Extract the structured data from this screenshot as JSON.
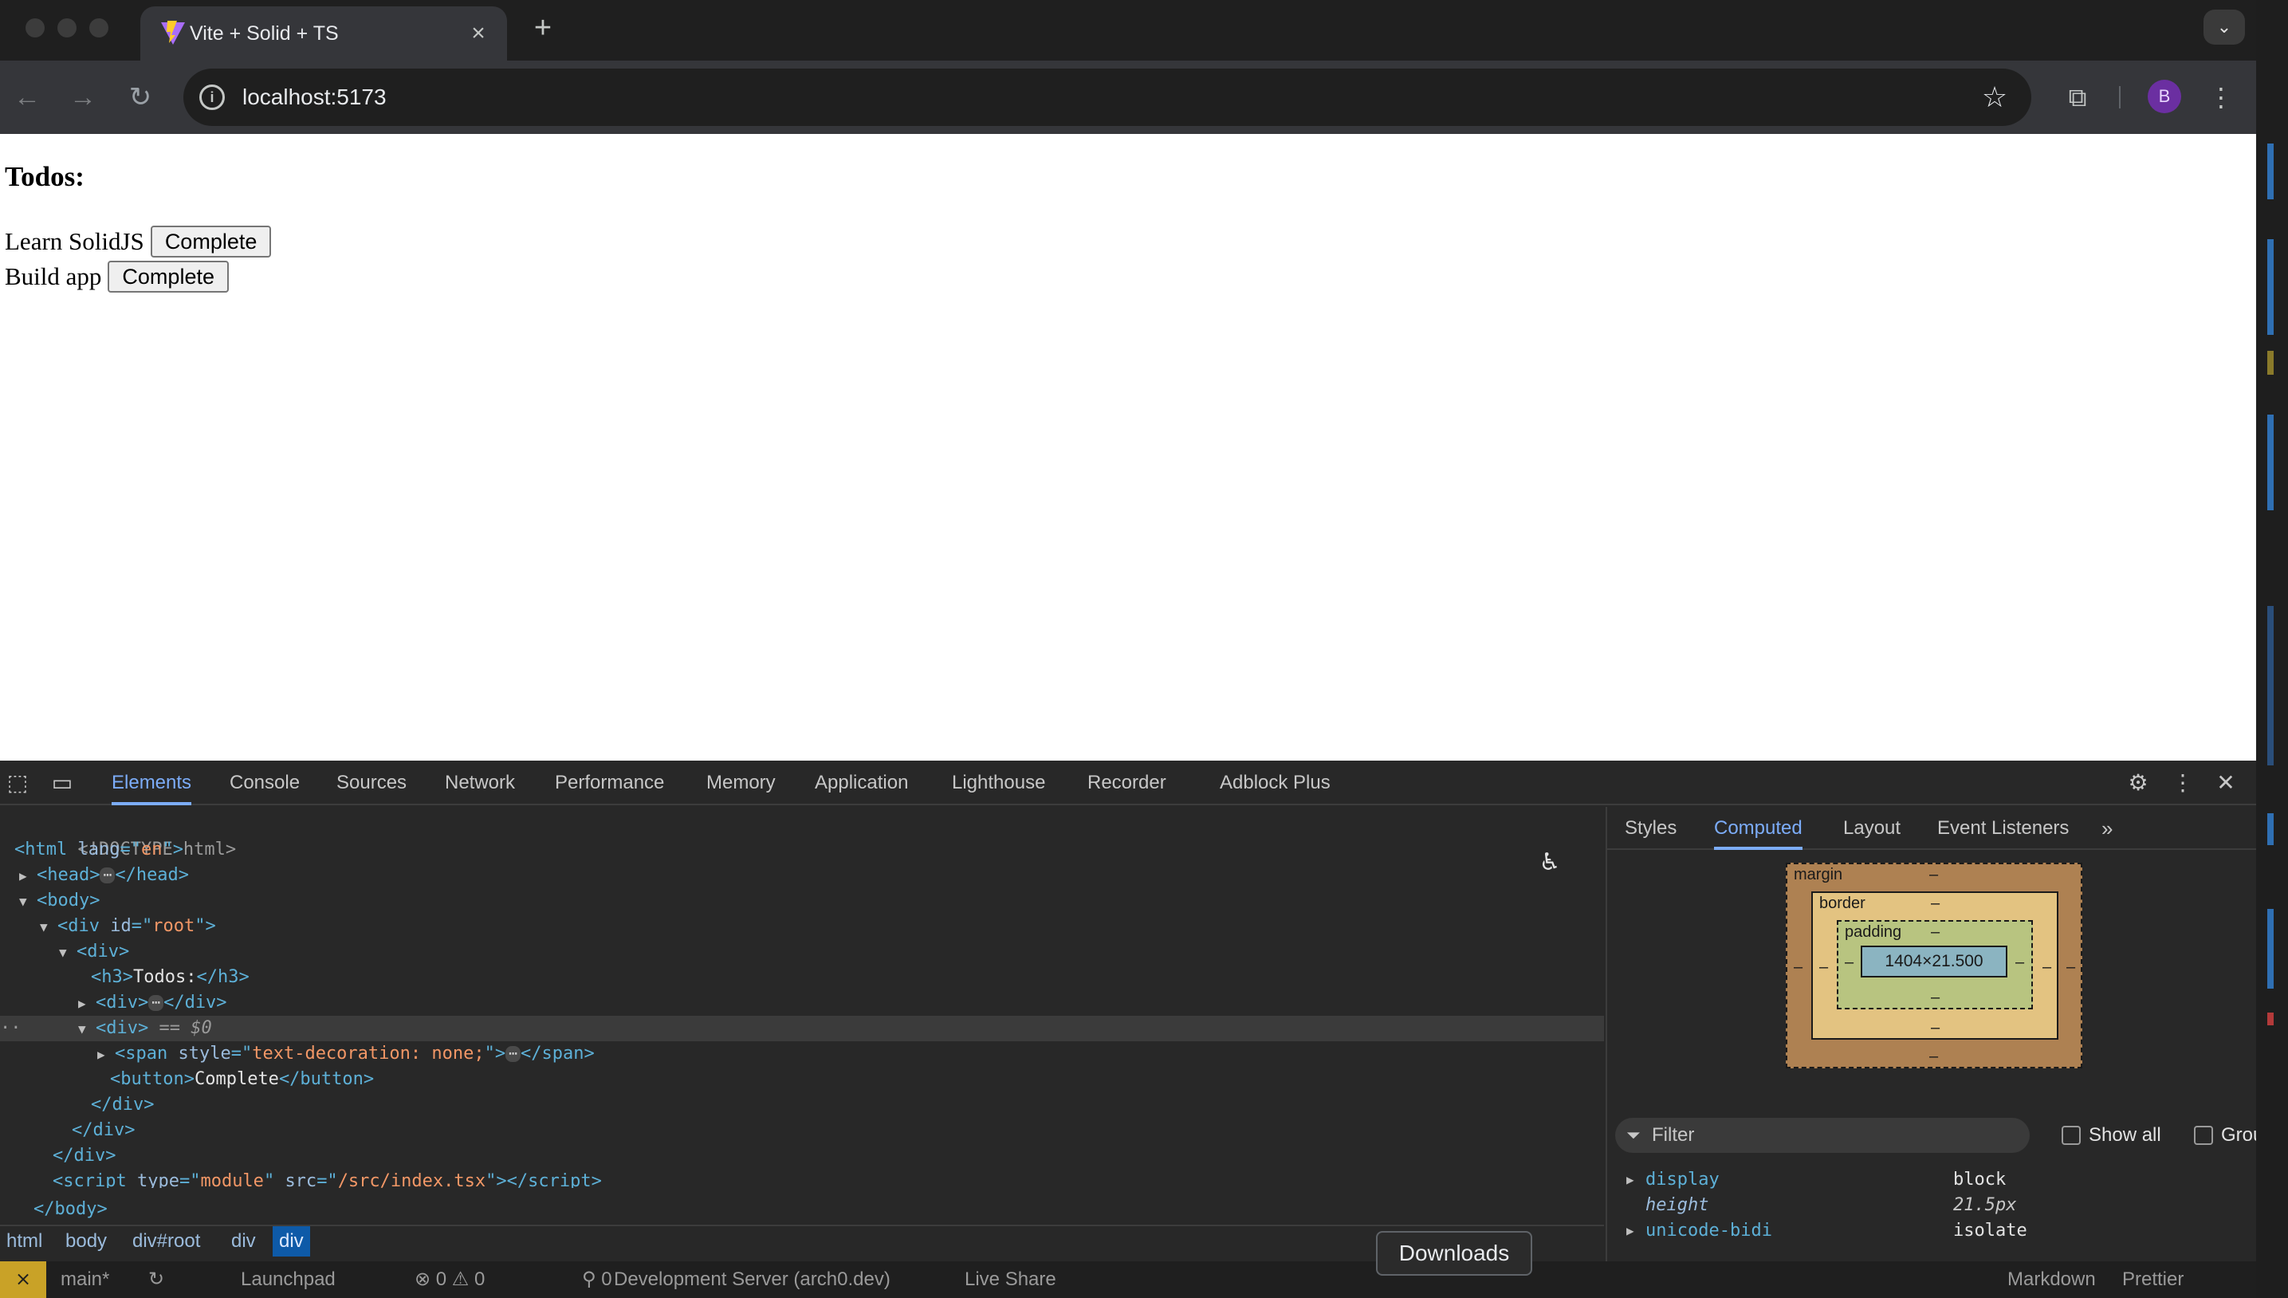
{
  "browser": {
    "tab_title": "Vite + Solid + TS",
    "url": "localhost:5173",
    "avatar_letter": "B"
  },
  "page": {
    "heading": "Todos:",
    "todos": [
      {
        "text": "Learn SolidJS",
        "button": "Complete"
      },
      {
        "text": "Build app",
        "button": "Complete"
      }
    ]
  },
  "devtools": {
    "tabs": [
      "Elements",
      "Console",
      "Sources",
      "Network",
      "Performance",
      "Memory",
      "Application",
      "Lighthouse",
      "Recorder",
      "Adblock Plus"
    ],
    "active_tab": "Elements",
    "dom": {
      "doctype": "<!DOCTYPE html>",
      "html_lang": "en",
      "root_id": "root",
      "h3_text": "Todos:",
      "span_style": "text-decoration: none;",
      "button_text": "Complete",
      "selected_marker": "== $0",
      "script_type": "module",
      "script_src": "/src/index.tsx"
    },
    "breadcrumbs": [
      "html",
      "body",
      "div#root",
      "div",
      "div"
    ],
    "side_tabs": [
      "Styles",
      "Computed",
      "Layout",
      "Event Listeners"
    ],
    "side_active": "Computed",
    "box_model": {
      "margin_label": "margin",
      "border_label": "border",
      "padding_label": "padding",
      "content_size": "1404×21.500",
      "dash": "–"
    },
    "filter_placeholder": "Filter",
    "show_all_label": "Show all",
    "group_label": "Group",
    "computed": [
      {
        "name": "display",
        "value": "block",
        "inherited": false,
        "expandable": true
      },
      {
        "name": "height",
        "value": "21.5px",
        "inherited": true,
        "expandable": false
      },
      {
        "name": "unicode-bidi",
        "value": "isolate",
        "inherited": false,
        "expandable": true
      }
    ]
  },
  "tooltip": "Downloads",
  "statusbar": {
    "branch": "main*",
    "launchpad": "Launchpad",
    "counts": "⊗ 0 ⚠ 0",
    "ports": "⚲ 0",
    "server": "Development Server (arch0.dev)",
    "liveshare": "Live Share",
    "language": "Markdown",
    "prettier": "Prettier"
  },
  "colors": {
    "accent": "#7cacf8",
    "selected_crumb": "#0e5aa8"
  }
}
